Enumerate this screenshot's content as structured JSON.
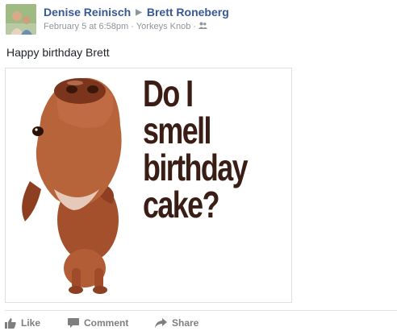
{
  "post": {
    "author": "Denise Reinisch",
    "recipient": "Brett Roneberg",
    "timestamp": "February 5 at 6:58pm",
    "location": "Yorkeys Knob",
    "privacy_icon": "friends-icon",
    "text": "Happy birthday Brett",
    "photo": {
      "caption_line1": "Do I smell",
      "caption_line2": "birthday",
      "caption_line3": "cake?"
    }
  },
  "actions": {
    "like_label": "Like",
    "comment_label": "Comment",
    "share_label": "Share"
  },
  "colors": {
    "link": "#365899",
    "meta": "#90949c",
    "action": "#7f7f7f",
    "caption": "#3a1d14"
  }
}
